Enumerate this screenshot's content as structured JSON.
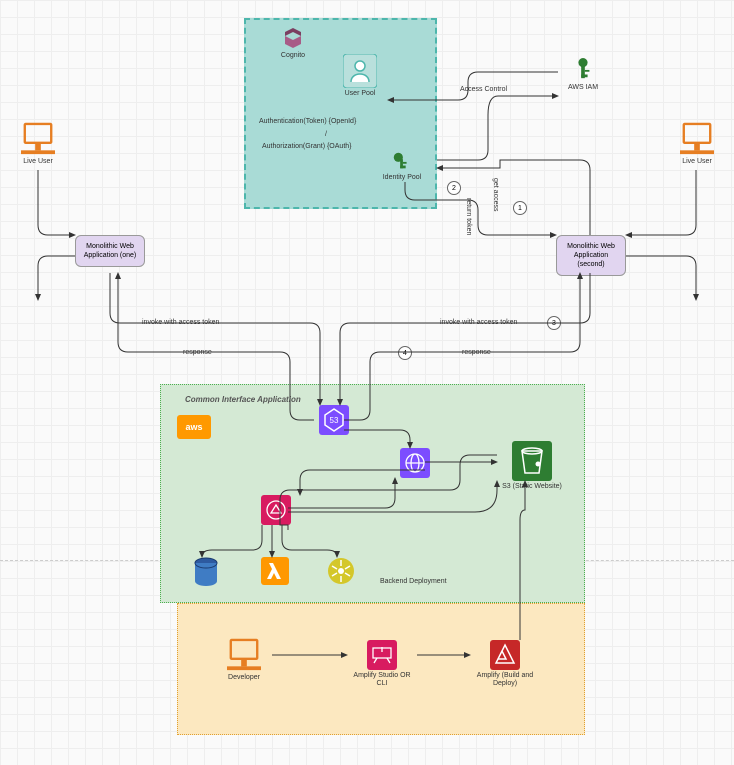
{
  "regions": {
    "cognito": "Cognito",
    "common": "Common Interface Application"
  },
  "nodes": {
    "liveUser1": "Live User",
    "liveUser2": "Live User",
    "userPool": "User Pool",
    "identityPool": "Identity Pool",
    "iam": "AWS IAM",
    "app1": "Monolithic Web Application (one)",
    "app2": "Monolithic Web Application (second)",
    "s3": "S3 (Static Website)",
    "backend": "Backend Deployment",
    "developer": "Developer",
    "amplifyStudio": "Amplify Studio OR CLI",
    "amplify": "Amplify (Build and Deploy)"
  },
  "edges": {
    "accessControl": "Access Control",
    "auth": "Authentication(Token) {OpenId}",
    "authz": "Authorization(Grant) {OAuth}",
    "slash": "/",
    "getAccess": "get access",
    "returnToken": "return token",
    "invoke1": "invoke with access token",
    "invoke2": "invoke with access token",
    "resp1": "response",
    "resp2": "response"
  },
  "steps": {
    "s1": "1",
    "s2": "2",
    "s3": "3",
    "s4": "4"
  },
  "aws": "aws"
}
